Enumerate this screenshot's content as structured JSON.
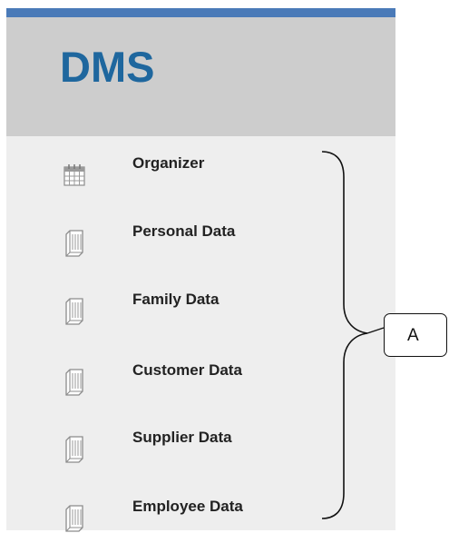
{
  "app": {
    "logo_text": "DMS"
  },
  "colors": {
    "top_strip": "#4a7ab8",
    "header_bg": "#cdcdcd",
    "panel_bg": "#eeeeee",
    "logo": "#1f679e"
  },
  "nav": {
    "items": [
      {
        "label": "Organizer",
        "icon": "calendar-icon"
      },
      {
        "label": "Personal Data",
        "icon": "document-stack-icon"
      },
      {
        "label": "Family Data",
        "icon": "document-stack-icon"
      },
      {
        "label": "Customer Data",
        "icon": "document-stack-icon"
      },
      {
        "label": "Supplier Data",
        "icon": "document-stack-icon"
      },
      {
        "label": "Employee Data",
        "icon": "document-stack-icon"
      }
    ]
  },
  "annotation": {
    "callout_label": "A"
  }
}
